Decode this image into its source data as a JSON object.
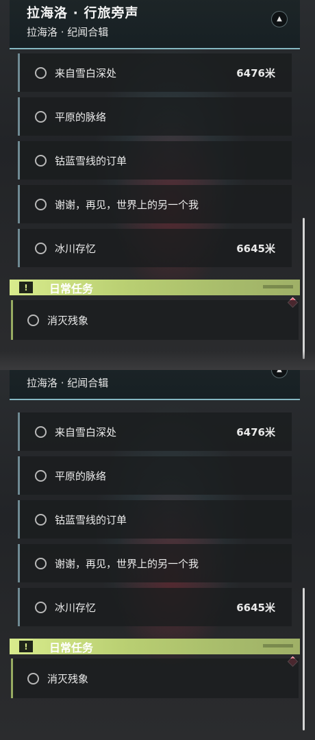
{
  "header": {
    "title": "拉海洛 · 行旅旁声",
    "subtitle": "拉海洛 · 纪闻合辑",
    "collapse_icon": "chevron-up-icon"
  },
  "quests": [
    {
      "name": "来自雪白深处",
      "distance": "6476米"
    },
    {
      "name": "平原的脉络",
      "distance": ""
    },
    {
      "name": "钴蓝雪线的订单",
      "distance": ""
    },
    {
      "name": "谢谢，再见，世界上的另一个我",
      "distance": ""
    },
    {
      "name": "冰川存忆",
      "distance": "6645米"
    }
  ],
  "daily": {
    "title": "日常任务",
    "icon": "alert-icon",
    "items": [
      {
        "name": "消灭残象"
      }
    ],
    "marker_icon": "diamond-marker-icon"
  },
  "colors": {
    "accent_cyan": "#86b9c3",
    "daily_green": "#c8dd7c",
    "marker_red": "#d54a62"
  }
}
